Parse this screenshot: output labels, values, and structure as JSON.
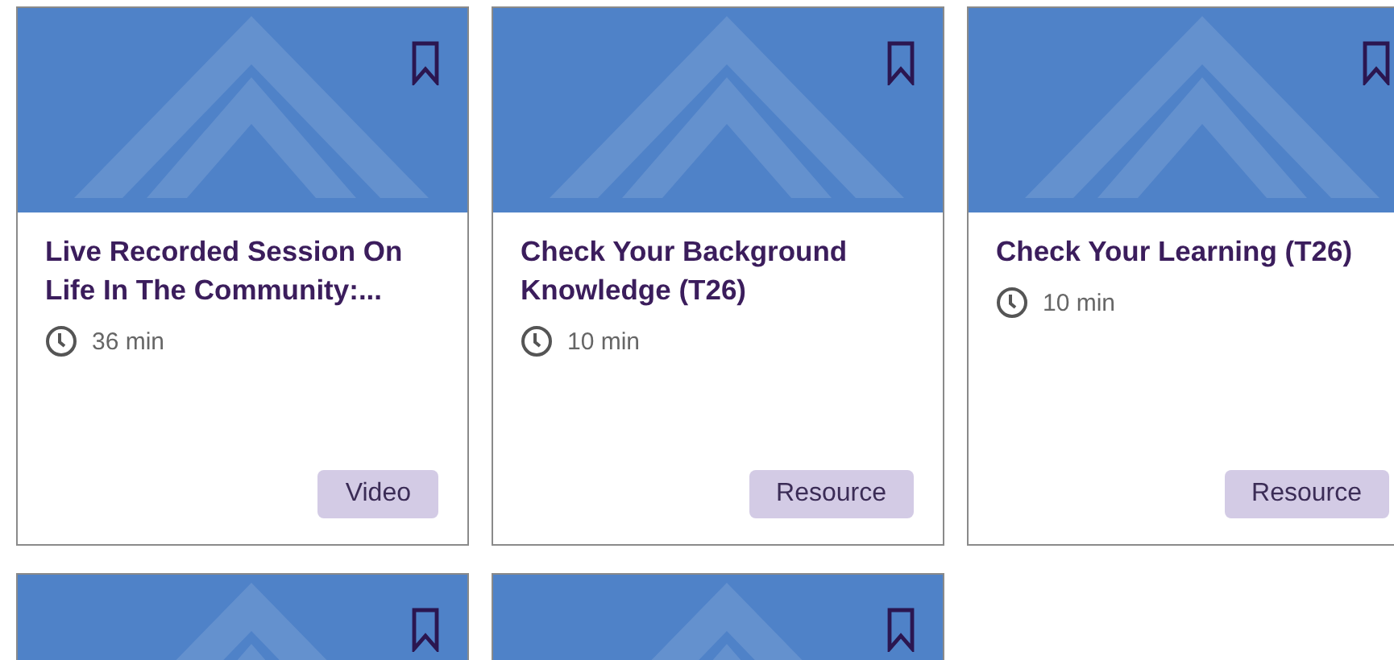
{
  "cards": [
    {
      "kind": "full",
      "title": "Live Recorded Session On Life In The Community:...",
      "duration": "36 min",
      "type": "Video"
    },
    {
      "kind": "full",
      "title": "Check Your Background Knowledge (T26)",
      "duration": "10 min",
      "type": "Resource"
    },
    {
      "kind": "full",
      "title": "Check Your Learning (T26)",
      "duration": "10 min",
      "type": "Resource"
    },
    {
      "kind": "banner"
    },
    {
      "kind": "banner"
    }
  ]
}
